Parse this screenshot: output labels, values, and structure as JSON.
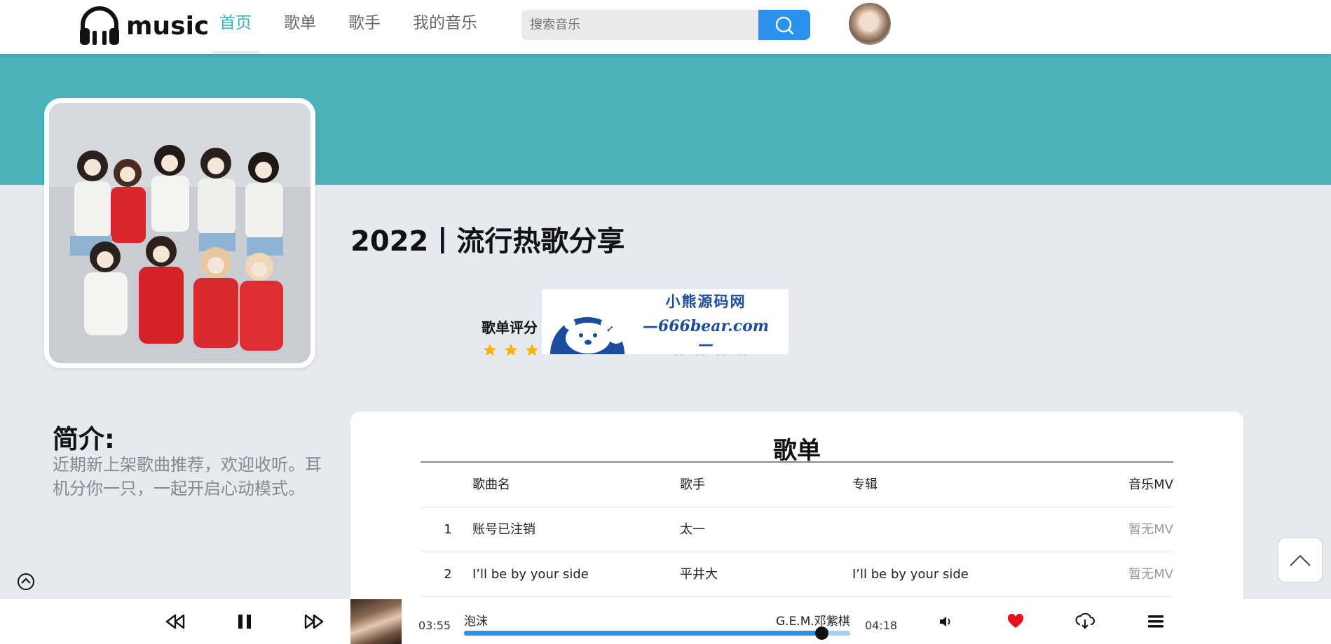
{
  "header": {
    "logo_text": "music",
    "nav": [
      {
        "label": "首页",
        "active": true
      },
      {
        "label": "歌单",
        "active": false
      },
      {
        "label": "歌手",
        "active": false
      },
      {
        "label": "我的音乐",
        "active": false
      }
    ],
    "search_placeholder": "搜索音乐",
    "search_icon": "search-icon",
    "accent_color": "#3db2b4",
    "button_color": "#2b91ec"
  },
  "banner": {
    "color": "#4cb3bb"
  },
  "playlist": {
    "title": "2022丨流行热歌分享",
    "rating_label": "歌单评分",
    "rating_filled": 3,
    "rating_total": 5,
    "watermark_line1": "小熊源码网",
    "watermark_line2": "—666bear.com—"
  },
  "intro": {
    "title": "简介:",
    "text": "近期新上架歌曲推荐，欢迎收听。耳机分你一只，一起开启心动模式。"
  },
  "songlist": {
    "title": "歌单",
    "columns": {
      "name": "歌曲名",
      "singer": "歌手",
      "album": "专辑",
      "mv": "音乐MV"
    },
    "rows": [
      {
        "index": "1",
        "name": "账号已注销",
        "singer": "太一",
        "album": "",
        "mv": "暂无MV"
      },
      {
        "index": "2",
        "name": "I’ll be by your side",
        "singer": "平井大",
        "album": "I’ll be by your side",
        "mv": "暂无MV"
      }
    ]
  },
  "player": {
    "current_time": "03:55",
    "total_time": "04:18",
    "song": "泡沫",
    "artist": "G.E.M.邓紫棋",
    "progress_fraction": 0.925,
    "liked": true,
    "like_color": "#e8101b",
    "icons": [
      "prev-icon",
      "pause-icon",
      "next-icon",
      "volume-icon",
      "heart-icon",
      "download-icon",
      "playlist-menu-icon"
    ]
  }
}
